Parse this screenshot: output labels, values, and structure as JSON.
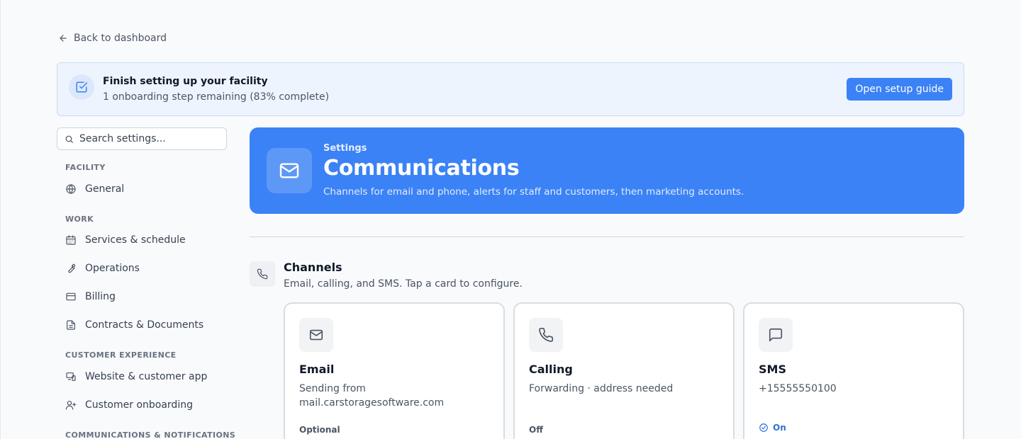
{
  "nav_back": {
    "label": "Back to dashboard"
  },
  "setup": {
    "title": "Finish setting up your facility",
    "subtitle": "1 onboarding step remaining (83% complete)",
    "progress_percent": 83,
    "button_label": "Open setup guide"
  },
  "search": {
    "placeholder": "Search settings..."
  },
  "sidebar": {
    "sections": [
      {
        "title": "FACILITY",
        "items": [
          {
            "label": "General",
            "icon": "globe-icon"
          }
        ]
      },
      {
        "title": "WORK",
        "items": [
          {
            "label": "Services & schedule",
            "icon": "calendar-icon"
          },
          {
            "label": "Operations",
            "icon": "wrench-icon"
          },
          {
            "label": "Billing",
            "icon": "credit-card-icon"
          },
          {
            "label": "Contracts & Documents",
            "icon": "document-icon"
          }
        ]
      },
      {
        "title": "CUSTOMER EXPERIENCE",
        "items": [
          {
            "label": "Website & customer app",
            "icon": "devices-icon"
          },
          {
            "label": "Customer onboarding",
            "icon": "user-plus-icon"
          }
        ]
      },
      {
        "title": "COMMUNICATIONS & NOTIFICATIONS",
        "items": []
      }
    ]
  },
  "hero": {
    "kicker": "Settings",
    "title": "Communications",
    "description": "Channels for email and phone, alerts for staff and customers, then marketing accounts.",
    "icon": "mail-icon"
  },
  "channels": {
    "title": "Channels",
    "subtitle": "Email, calling, and SMS. Tap a card to configure.",
    "icon": "phone-icon",
    "cards": [
      {
        "title": "Email",
        "description": "Sending from mail.carstoragesoftware.com",
        "status": "Optional",
        "icon": "mail-icon"
      },
      {
        "title": "Calling",
        "description": "Forwarding · address needed",
        "status": "Off",
        "icon": "phone-icon"
      },
      {
        "title": "SMS",
        "description": "+15555550100",
        "status": "On",
        "icon": "message-icon"
      }
    ]
  },
  "colors": {
    "accent": "#3b82f6",
    "banner_bg": "#eef4fd",
    "status_on": "#2f6fd8"
  }
}
